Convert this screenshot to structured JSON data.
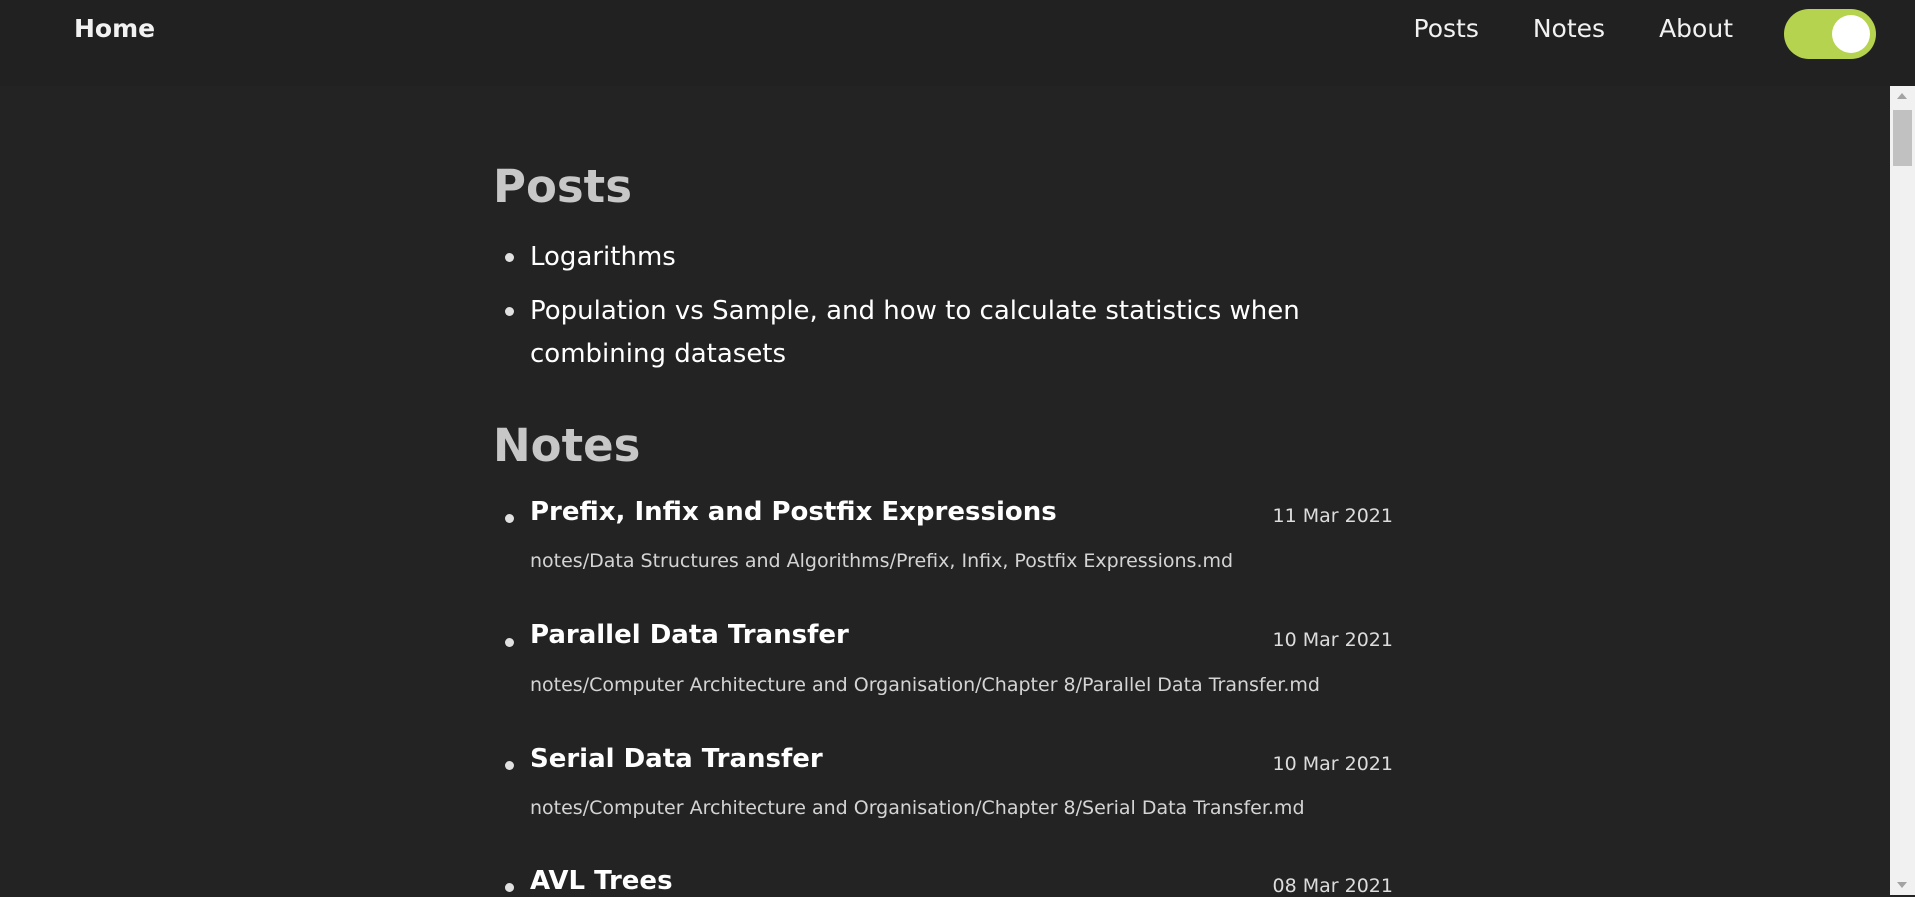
{
  "nav": {
    "home": "Home",
    "links": [
      "Posts",
      "Notes",
      "About"
    ],
    "theme_toggle_on": true
  },
  "colors": {
    "background": "#232323",
    "toggle": "#b5d34e",
    "heading": "#c7c7c7"
  },
  "posts": {
    "title": "Posts",
    "items": [
      "Logarithms",
      "Population vs Sample, and how to calculate statistics when combining datasets"
    ]
  },
  "notes": {
    "title": "Notes",
    "items": [
      {
        "title": "Prefix, Infix and Postfix Expressions",
        "date": "11 Mar 2021",
        "path": "notes/Data Structures and Algorithms/Prefix, Infix, Postfix Expressions.md"
      },
      {
        "title": "Parallel Data Transfer",
        "date": "10 Mar 2021",
        "path": "notes/Computer Architecture and Organisation/Chapter 8/Parallel Data Transfer.md"
      },
      {
        "title": "Serial Data Transfer",
        "date": "10 Mar 2021",
        "path": "notes/Computer Architecture and Organisation/Chapter 8/Serial Data Transfer.md"
      },
      {
        "title": "AVL Trees",
        "date": "08 Mar 2021",
        "path": ""
      }
    ]
  }
}
